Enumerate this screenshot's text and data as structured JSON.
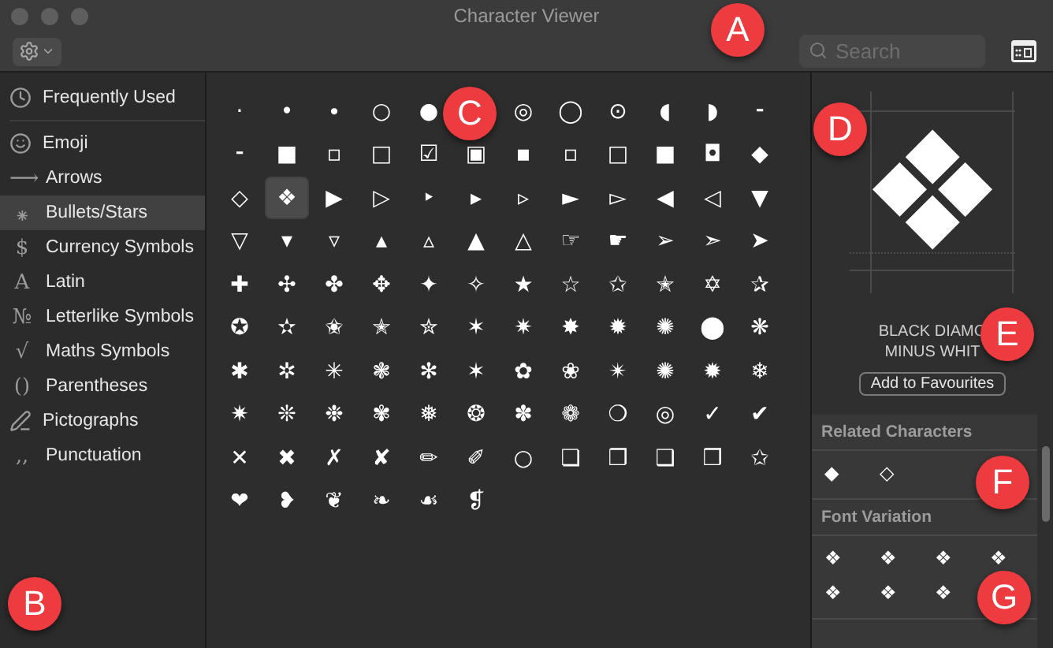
{
  "window": {
    "title": "Character Viewer"
  },
  "toolbar": {
    "search": {
      "placeholder": "Search"
    }
  },
  "sidebar": {
    "items": [
      {
        "label": "Frequently Used",
        "kind": "icon",
        "selected": false
      },
      {
        "label": "Emoji",
        "kind": "icon",
        "selected": false
      },
      {
        "label": "Arrows",
        "glyph": "⟶",
        "selected": false
      },
      {
        "label": "Bullets/Stars",
        "glyph": "⁕",
        "selected": true
      },
      {
        "label": "Currency Symbols",
        "glyph": "$",
        "selected": false
      },
      {
        "label": "Latin",
        "glyph": "A",
        "selected": false
      },
      {
        "label": "Letterlike Symbols",
        "glyph": "№",
        "selected": false
      },
      {
        "label": "Maths Symbols",
        "glyph": "√",
        "selected": false
      },
      {
        "label": "Parentheses",
        "glyph": "()",
        "selected": false
      },
      {
        "label": "Pictographs",
        "kind": "icon",
        "selected": false
      },
      {
        "label": "Punctuation",
        "glyph": "‚,",
        "selected": false
      }
    ]
  },
  "grid": {
    "characters": [
      {
        "char": "·",
        "selected": false
      },
      {
        "char": "•",
        "selected": false
      },
      {
        "char": "∙",
        "selected": false
      },
      {
        "char": "○",
        "selected": false
      },
      {
        "char": "●",
        "selected": false
      },
      {
        "char": "◎",
        "selected": false
      },
      {
        "char": "◯",
        "selected": false
      },
      {
        "char": "⊙",
        "selected": false
      },
      {
        "char": "◖",
        "selected": false
      },
      {
        "char": "◗",
        "selected": false
      },
      {
        "char": "⁃",
        "selected": false
      },
      {
        "char": "⁃",
        "selected": false
      },
      {
        "char": "■",
        "selected": false
      },
      {
        "char": "▫",
        "selected": false
      },
      {
        "char": "□",
        "selected": false
      },
      {
        "char": "☑",
        "selected": false
      },
      {
        "char": "▣",
        "selected": false
      },
      {
        "char": "▪",
        "selected": false
      },
      {
        "char": "▫",
        "selected": false
      },
      {
        "char": "□",
        "selected": false
      },
      {
        "char": "■",
        "selected": false
      },
      {
        "char": "◘",
        "selected": false
      },
      {
        "char": "◆",
        "selected": false
      },
      {
        "char": "◇",
        "selected": false
      },
      {
        "char": "❖",
        "selected": true
      },
      {
        "char": "▶",
        "selected": false
      },
      {
        "char": "▷",
        "selected": false
      },
      {
        "char": "‣",
        "selected": false
      },
      {
        "char": "▸",
        "selected": false
      },
      {
        "char": "▹",
        "selected": false
      },
      {
        "char": "►",
        "selected": false
      },
      {
        "char": "▻",
        "selected": false
      },
      {
        "char": "◀",
        "selected": false
      },
      {
        "char": "◁",
        "selected": false
      },
      {
        "char": "▼",
        "selected": false
      },
      {
        "char": "▽",
        "selected": false
      },
      {
        "char": "▾",
        "selected": false
      },
      {
        "char": "▿",
        "selected": false
      },
      {
        "char": "▴",
        "selected": false
      },
      {
        "char": "▵",
        "selected": false
      },
      {
        "char": "▲",
        "selected": false
      },
      {
        "char": "△",
        "selected": false
      },
      {
        "char": "☞",
        "selected": false
      },
      {
        "char": "☛",
        "selected": false
      },
      {
        "char": "➢",
        "selected": false
      },
      {
        "char": "➣",
        "selected": false
      },
      {
        "char": "➤",
        "selected": false
      },
      {
        "char": "✚",
        "selected": false
      },
      {
        "char": "✣",
        "selected": false
      },
      {
        "char": "✤",
        "selected": false
      },
      {
        "char": "✥",
        "selected": false
      },
      {
        "char": "✦",
        "selected": false
      },
      {
        "char": "✧",
        "selected": false
      },
      {
        "char": "★",
        "selected": false
      },
      {
        "char": "☆",
        "selected": false
      },
      {
        "char": "✩",
        "selected": false
      },
      {
        "char": "✭",
        "selected": false
      },
      {
        "char": "✡",
        "selected": false
      },
      {
        "char": "✰",
        "selected": false
      },
      {
        "char": "✪",
        "selected": false
      },
      {
        "char": "✫",
        "selected": false
      },
      {
        "char": "✬",
        "selected": false
      },
      {
        "char": "✭",
        "selected": false
      },
      {
        "char": "✮",
        "selected": false
      },
      {
        "char": "✶",
        "selected": false
      },
      {
        "char": "✷",
        "selected": false
      },
      {
        "char": "✸",
        "selected": false
      },
      {
        "char": "✹",
        "selected": false
      },
      {
        "char": "✺",
        "selected": false
      },
      {
        "char": "⬤",
        "selected": false
      },
      {
        "char": "❋",
        "selected": false
      },
      {
        "char": "✱",
        "selected": false
      },
      {
        "char": "✲",
        "selected": false
      },
      {
        "char": "✳",
        "selected": false
      },
      {
        "char": "❃",
        "selected": false
      },
      {
        "char": "✻",
        "selected": false
      },
      {
        "char": "✶",
        "selected": false
      },
      {
        "char": "✿",
        "selected": false
      },
      {
        "char": "❀",
        "selected": false
      },
      {
        "char": "✴",
        "selected": false
      },
      {
        "char": "✺",
        "selected": false
      },
      {
        "char": "✹",
        "selected": false
      },
      {
        "char": "❄",
        "selected": false
      },
      {
        "char": "✷",
        "selected": false
      },
      {
        "char": "❊",
        "selected": false
      },
      {
        "char": "❉",
        "selected": false
      },
      {
        "char": "✾",
        "selected": false
      },
      {
        "char": "❅",
        "selected": false
      },
      {
        "char": "❂",
        "selected": false
      },
      {
        "char": "✽",
        "selected": false
      },
      {
        "char": "❁",
        "selected": false
      },
      {
        "char": "❍",
        "selected": false
      },
      {
        "char": "◎",
        "selected": false
      },
      {
        "char": "✓",
        "selected": false
      },
      {
        "char": "✔",
        "selected": false
      },
      {
        "char": "✕",
        "selected": false
      },
      {
        "char": "✖",
        "selected": false
      },
      {
        "char": "✗",
        "selected": false
      },
      {
        "char": "✘",
        "selected": false
      },
      {
        "char": "✏",
        "selected": false
      },
      {
        "char": "✐",
        "selected": false
      },
      {
        "char": "○",
        "selected": false
      },
      {
        "char": "❏",
        "selected": false
      },
      {
        "char": "❐",
        "selected": false
      },
      {
        "char": "❑",
        "selected": false
      },
      {
        "char": "❒",
        "selected": false
      },
      {
        "char": "✩",
        "selected": false
      },
      {
        "char": "❤",
        "selected": false
      },
      {
        "char": "❥",
        "selected": false
      },
      {
        "char": "❦",
        "selected": false
      },
      {
        "char": "❧",
        "selected": false
      },
      {
        "char": "☙",
        "selected": false
      },
      {
        "char": "❡",
        "selected": false
      }
    ]
  },
  "detail": {
    "preview_char": "❖",
    "name_lines": [
      "BLACK DIAMO",
      "MINUS WHIT"
    ],
    "button": "Add to Favourites",
    "sections": [
      {
        "title": "Related Characters",
        "characters": [
          "◆",
          "◇"
        ]
      },
      {
        "title": "Font Variation",
        "characters": [
          "❖",
          "❖",
          "❖",
          "❖",
          "❖",
          "❖",
          "❖"
        ]
      }
    ]
  },
  "annotations": [
    {
      "label": "A"
    },
    {
      "label": "B"
    },
    {
      "label": "C"
    },
    {
      "label": "D"
    },
    {
      "label": "E"
    },
    {
      "label": "F"
    },
    {
      "label": "G"
    }
  ]
}
